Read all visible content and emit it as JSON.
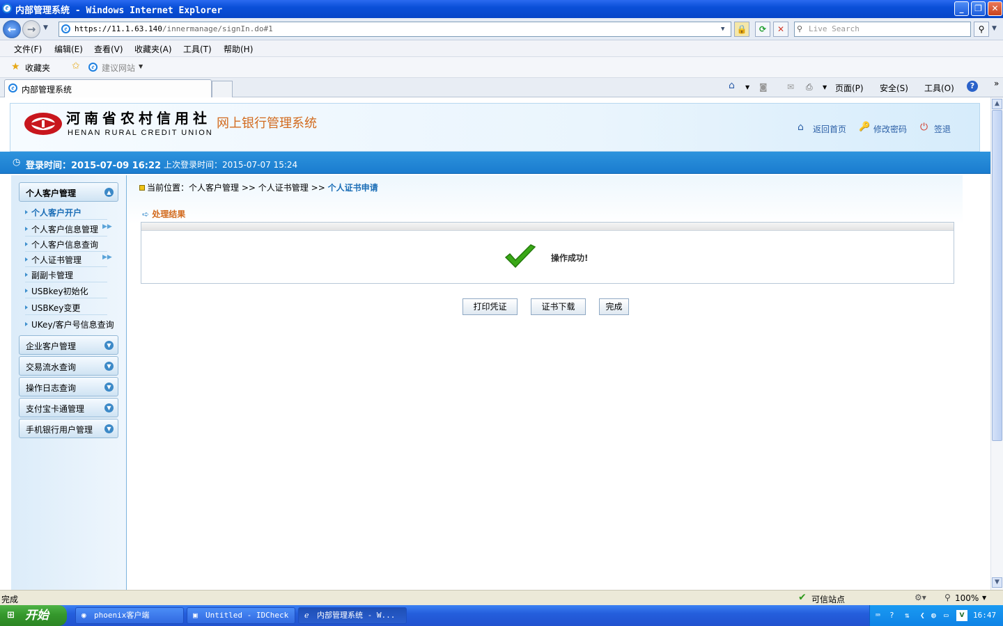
{
  "window": {
    "title": "内部管理系统 - Windows Internet Explorer"
  },
  "address": {
    "host": "https://11.1.63.140",
    "path": "/innermanage/signIn.do#1",
    "search_placeholder": "Live Search"
  },
  "menu": [
    "文件(F)",
    "编辑(E)",
    "查看(V)",
    "收藏夹(A)",
    "工具(T)",
    "帮助(H)"
  ],
  "favbar": {
    "favorites": "收藏夹",
    "suggested": "建议网站"
  },
  "tab": {
    "label": "内部管理系统"
  },
  "commands": {
    "page": "页面(P)",
    "safety": "安全(S)",
    "tools": "工具(O)"
  },
  "site": {
    "cn_name": "河南省农村信用社",
    "en_name": "HENAN RURAL CREDIT UNION",
    "system_name": "网上银行管理系统",
    "links": {
      "home": "返回首页",
      "password": "修改密码",
      "logout": "签退"
    }
  },
  "login": {
    "current": "登录时间：2015-07-09 16:22",
    "last": "上次登录时间：2015-07-07 15:24"
  },
  "sidebar": {
    "active_group": "个人客户管理",
    "items": [
      {
        "label": "个人客户开户"
      },
      {
        "label": "个人客户信息管理"
      },
      {
        "label": "个人客户信息查询"
      },
      {
        "label": "个人证书管理"
      },
      {
        "label": "副副卡管理"
      },
      {
        "label": "USBkey初始化"
      },
      {
        "label": "USBKey变更"
      },
      {
        "label": "UKey/客户号信息查询"
      }
    ],
    "groups": [
      "企业客户管理",
      "交易流水查询",
      "操作日志查询",
      "支付宝卡通管理",
      "手机银行用户管理"
    ]
  },
  "breadcrumb": {
    "prefix": "当前位置：",
    "p1": "个人客户管理",
    "sep": ">>",
    "p2": "个人证书管理",
    "p3": "个人证书申请"
  },
  "result": {
    "section": "处理结果",
    "message": "操作成功!"
  },
  "buttons": {
    "print": "打印凭证",
    "download": "证书下载",
    "done": "完成"
  },
  "status": {
    "text": "完成",
    "zone": "可信站点",
    "zoom": "100%"
  },
  "taskbar": {
    "start": "开始",
    "tasks": [
      "phoenix客户端",
      "Untitled - IDCheck",
      "内部管理系统 - W..."
    ],
    "clock": "16:47"
  },
  "colors": {
    "accent": "#1a7ccf",
    "brand_orange": "#d26a1d",
    "success_green": "#3aa817"
  }
}
